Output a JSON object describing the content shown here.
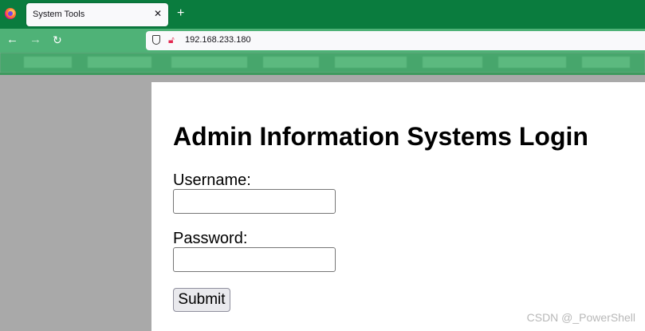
{
  "browser": {
    "tab": {
      "title": "System Tools",
      "close_glyph": "✕"
    },
    "new_tab_glyph": "+",
    "nav": {
      "back_glyph": "←",
      "forward_glyph": "→",
      "reload_glyph": "↻"
    },
    "url": "192.168.233.180",
    "icons": [
      "firefox-logo",
      "close-icon",
      "plus-icon",
      "back-arrow-icon",
      "forward-arrow-icon",
      "reload-icon",
      "shield-icon",
      "lock-insecure-icon"
    ]
  },
  "page": {
    "title": "Admin Information Systems Login",
    "username_label": "Username:",
    "username_value": "",
    "password_label": "Password:",
    "password_value": "",
    "submit_label": "Submit"
  },
  "watermark": "CSDN @_PowerShell",
  "colors": {
    "tabstrip": "#0a7c3e",
    "navbar": "#4fb277",
    "page_bg": "#ffffff",
    "outside_bg": "#a9a9a9",
    "insecure_lock": "#e22850"
  }
}
